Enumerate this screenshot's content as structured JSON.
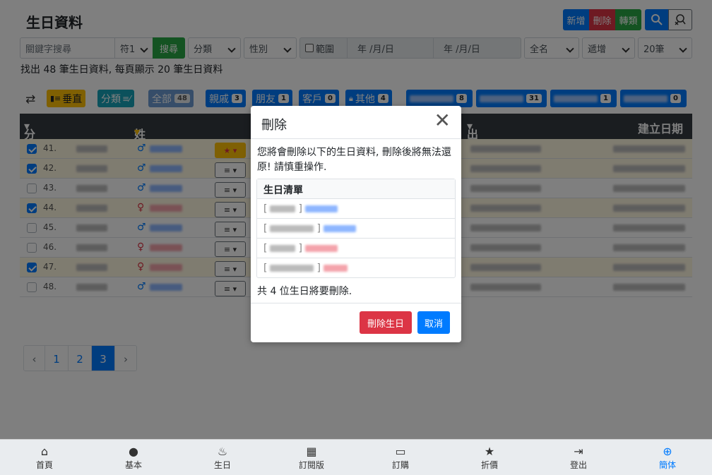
{
  "header": {
    "title": "生日資料"
  },
  "toolbar": {
    "add_label": "新增",
    "delete_label": "刪除",
    "convert_label": "轉類",
    "add_color": "#007bff",
    "delete_color": "#dc3545",
    "convert_color": "#28a745"
  },
  "filters": {
    "keyword_placeholder": "關鍵字搜尋",
    "match_value": "符1",
    "search_label": "搜尋",
    "category_value": "分類",
    "gender_value": "性別",
    "range_label": "範圍",
    "date_from_placeholder": "年 /月/日",
    "date_to_placeholder": "年 /月/日",
    "name_mode_value": "全名",
    "sort_value": "遞增",
    "per_page_value": "20筆"
  },
  "summary": "找出 48 筆生日資料, 每頁顯示 20 筆生日資料",
  "chips": {
    "vertical_label": "垂直",
    "category_label": "分類",
    "all_label": "全部",
    "all_count": "48",
    "relatives_label": "親戚",
    "relatives_count": "3",
    "friends_label": "朋友",
    "friends_count": "1",
    "clients_label": "客戶",
    "clients_count": "0",
    "others_label": "其他",
    "others_count": "4",
    "hidden1_count": "8",
    "hidden2_count": "31",
    "hidden3_count": "1",
    "hidden4_count": "0"
  },
  "table": {
    "headers": {
      "category": "分類",
      "name": "姓名",
      "country": "出生國家/城市",
      "created": "建立日期"
    },
    "rows": [
      {
        "num": "41.",
        "checked": true
      },
      {
        "num": "42.",
        "checked": true
      },
      {
        "num": "43.",
        "checked": false
      },
      {
        "num": "44.",
        "checked": true
      },
      {
        "num": "45.",
        "checked": false
      },
      {
        "num": "46.",
        "checked": false
      },
      {
        "num": "47.",
        "checked": true
      },
      {
        "num": "48.",
        "checked": false
      }
    ]
  },
  "pagination": {
    "prev": "‹",
    "next": "›",
    "pages": [
      "1",
      "2",
      "3"
    ],
    "current": "3"
  },
  "modal": {
    "title": "刪除",
    "close": "✕",
    "message": "您將會刪除以下的生日資料, 刪除後將無法還原! 請慎重操作.",
    "list_header": "生日清單",
    "count_text": "共 4 位生日將要刪除.",
    "confirm_label": "刪除生日",
    "cancel_label": "取消"
  },
  "bottom_nav": {
    "items": [
      "首頁",
      "基本",
      "生日",
      "訂閱版",
      "訂購",
      "折價",
      "登出",
      "簡体"
    ],
    "active": "簡体"
  }
}
